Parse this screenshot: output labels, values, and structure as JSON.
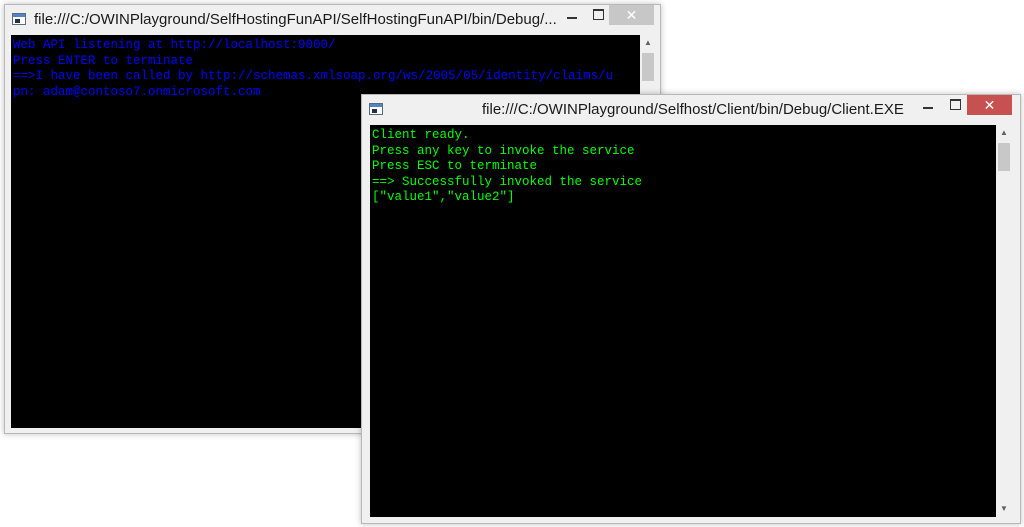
{
  "server_window": {
    "title": "file:///C:/OWINPlayground/SelfHostingFunAPI/SelfHostingFunAPI/bin/Debug/...",
    "controls": {
      "minimize": "",
      "maximize": "",
      "close": "✕"
    },
    "console_color": "#0000ff",
    "lines": [
      "Web API listening at http://localhost:9000/",
      "Press ENTER to terminate",
      "==>I have been called by http://schemas.xmlsoap.org/ws/2005/05/identity/claims/u",
      "pn: adam@contoso7.onmicrosoft.com"
    ]
  },
  "client_window": {
    "title": "file:///C:/OWINPlayground/Selfhost/Client/bin/Debug/Client.EXE",
    "controls": {
      "minimize": "",
      "maximize": "",
      "close": "✕"
    },
    "console_color": "#00ff00",
    "lines": [
      "Client ready.",
      "Press any key to invoke the service",
      "Press ESC to terminate",
      "==> Successfully invoked the service",
      "[\"value1\",\"value2\"]"
    ]
  },
  "icons": {
    "app": "console-app-icon",
    "scroll_up": "▲",
    "scroll_down": "▼"
  },
  "colors": {
    "console_background": "#000000",
    "close_button": "#c75050",
    "close_button_inactive": "#c7c7c7"
  }
}
